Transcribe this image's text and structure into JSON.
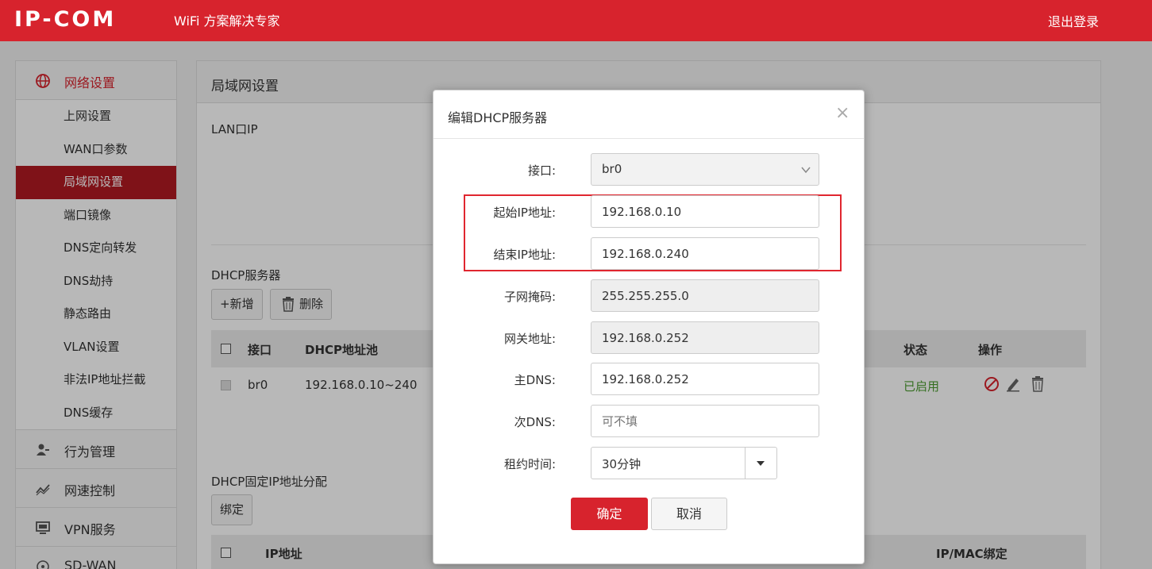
{
  "header": {
    "logo": "IP-COM",
    "slogan": "WiFi 方案解决专家",
    "logout": "退出登录",
    "brand_color": "#d7232d"
  },
  "sidebar": {
    "groups": [
      {
        "label": "网络设置",
        "icon": "globe-icon"
      },
      {
        "label": "行为管理",
        "icon": "user-manage-icon"
      },
      {
        "label": "网速控制",
        "icon": "speed-chart-icon"
      },
      {
        "label": "VPN服务",
        "icon": "monitor-icon"
      },
      {
        "label": "SD-WAN",
        "icon": "network-icon"
      }
    ],
    "items": [
      "上网设置",
      "WAN口参数",
      "局域网设置",
      "端口镜像",
      "DNS定向转发",
      "DNS劫持",
      "静态路由",
      "VLAN设置",
      "非法IP地址拦截",
      "DNS缓存"
    ],
    "active_item": "局域网设置"
  },
  "main": {
    "title": "局域网设置",
    "lan_ip_label": "LAN口IP",
    "dhcp_title": "DHCP服务器",
    "add_label": "+新增",
    "delete_label": "删除",
    "table_headers": {
      "iface": "接口",
      "pool": "DHCP地址池",
      "status": "状态",
      "action": "操作"
    },
    "row": {
      "iface": "br0",
      "pool": "192.168.0.10~240",
      "status": "已启用"
    },
    "fixed_title": "DHCP固定IP地址分配",
    "bind_label": "绑定",
    "table2_headers": {
      "ip": "IP地址",
      "bind": "IP/MAC绑定"
    }
  },
  "modal": {
    "title": "编辑DHCP服务器",
    "close": "×",
    "fields": {
      "iface_label": "接口:",
      "iface_value": "br0",
      "start_label": "起始IP地址:",
      "start_value": "192.168.0.10",
      "end_label": "结束IP地址:",
      "end_value": "192.168.0.240",
      "mask_label": "子网掩码:",
      "mask_value": "255.255.255.0",
      "gateway_label": "网关地址:",
      "gateway_value": "192.168.0.252",
      "dns1_label": "主DNS:",
      "dns1_value": "192.168.0.252",
      "dns2_label": "次DNS:",
      "dns2_placeholder": "可不填",
      "lease_label": "租约时间:",
      "lease_value": "30分钟"
    },
    "ok_label": "确定",
    "cancel_label": "取消"
  }
}
